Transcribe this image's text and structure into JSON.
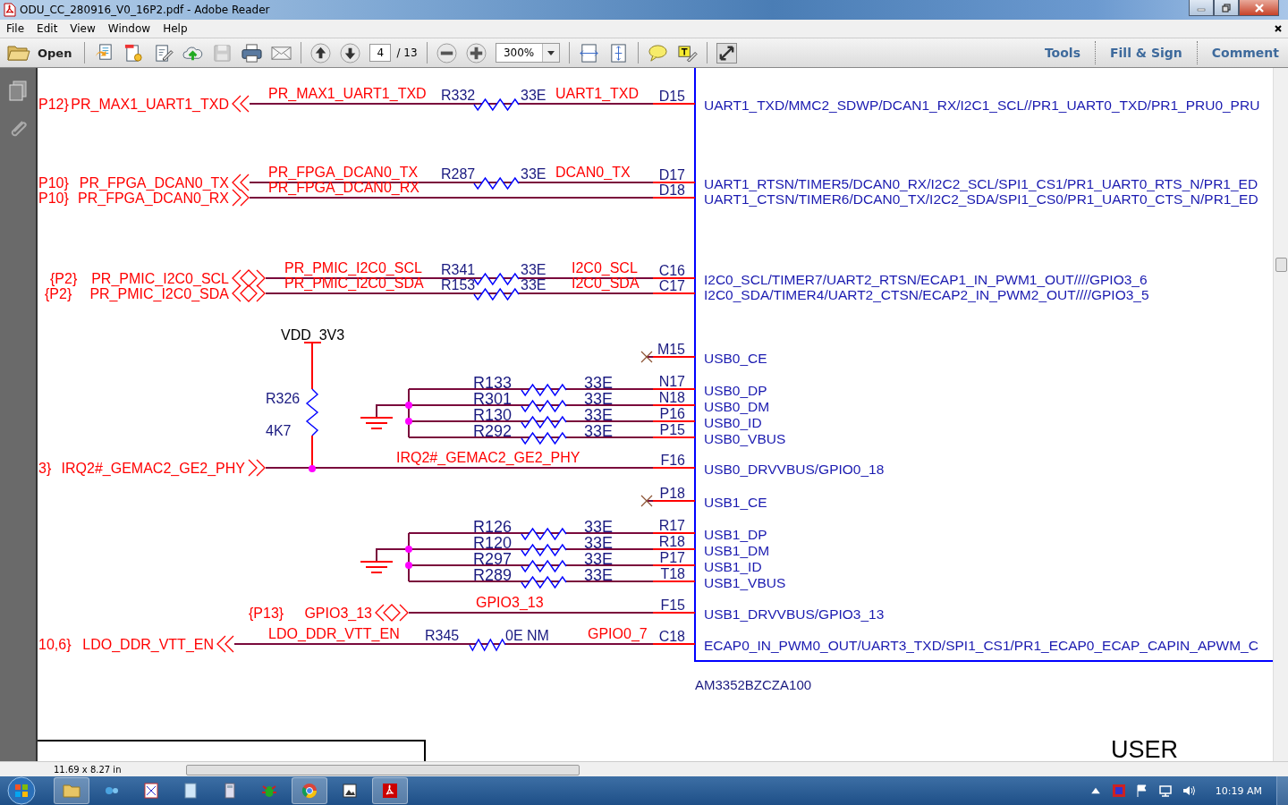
{
  "window": {
    "title": "ODU_CC_280916_V0_16P2.pdf - Adobe Reader"
  },
  "menu": [
    "File",
    "Edit",
    "View",
    "Window",
    "Help"
  ],
  "toolbar": {
    "open": "Open",
    "page": "4",
    "page_count": "/ 13",
    "zoom": "300%",
    "panels": [
      "Tools",
      "Fill & Sign",
      "Comment"
    ]
  },
  "schematic": {
    "rows": [
      {
        "kind": "series",
        "sheet_ref": "P12}",
        "port": {
          "net": "PR_MAX1_UART1_TXD",
          "kind": "output"
        },
        "net_label": "PR_MAX1_UART1_TXD",
        "res_ref": "R332",
        "res_value": "33E",
        "pin_net": "UART1_TXD",
        "pin": "D15",
        "pad": "UART1_TXD/MMC2_SDWP/DCAN1_RX/I2C1_SCL//PR1_UART0_TXD/PR1_PRU0_PRU"
      },
      {
        "kind": "series",
        "sheet_ref": "P10}",
        "port": {
          "net": "PR_FPGA_DCAN0_TX",
          "kind": "output"
        },
        "net_label": "PR_FPGA_DCAN0_TX",
        "res_ref": "R287",
        "res_value": "33E",
        "pin_net": "DCAN0_TX",
        "pin": "D17",
        "pad": "UART1_RTSN/TIMER5/DCAN0_RX/I2C2_SCL/SPI1_CS1/PR1_UART0_RTS_N/PR1_ED"
      },
      {
        "kind": "direct",
        "sheet_ref": "P10}",
        "port": {
          "net": "PR_FPGA_DCAN0_RX",
          "kind": "input"
        },
        "net_label": "PR_FPGA_DCAN0_RX",
        "pin": "D18",
        "pad": "UART1_CTSN/TIMER6/DCAN0_TX/I2C2_SDA/SPI1_CS0/PR1_UART0_CTS_N/PR1_ED"
      },
      {
        "kind": "series",
        "sheet_ref": "{P2}",
        "port": {
          "net": "PR_PMIC_I2C0_SCL",
          "kind": "bidir"
        },
        "net_label": "PR_PMIC_I2C0_SCL",
        "res_ref": "R341",
        "res_value": "33E",
        "pin_net": "I2C0_SCL",
        "pin": "C16",
        "pad": "I2C0_SCL/TIMER7/UART2_RTSN/ECAP1_IN_PWM1_OUT////GPIO3_6"
      },
      {
        "kind": "series",
        "sheet_ref": "{P2}",
        "port": {
          "net": "PR_PMIC_I2C0_SDA",
          "kind": "bidir"
        },
        "net_label": "PR_PMIC_I2C0_SDA",
        "res_ref": "R153",
        "res_value": "33E",
        "pin_net": "I2C0_SDA",
        "pin": "C17",
        "pad": "I2C0_SDA/TIMER4/UART2_CTSN/ECAP2_IN_PWM2_OUT////GPIO3_5"
      },
      {
        "kind": "nc",
        "pin": "M15",
        "pad": "USB0_CE"
      },
      {
        "kind": "usb",
        "res_ref": "R133",
        "res_value": "33E",
        "pin": "N17",
        "pad": "USB0_DP"
      },
      {
        "kind": "usb",
        "res_ref": "R301",
        "res_value": "33E",
        "pin": "N18",
        "pad": "USB0_DM"
      },
      {
        "kind": "usb",
        "res_ref": "R130",
        "res_value": "33E",
        "pin": "P16",
        "pad": "USB0_ID"
      },
      {
        "kind": "usb",
        "res_ref": "R292",
        "res_value": "33E",
        "pin": "P15",
        "pad": "USB0_VBUS"
      },
      {
        "kind": "direct",
        "sheet_ref": "3}",
        "port": {
          "net": "IRQ2#_GEMAC2_GE2_PHY",
          "kind": "input"
        },
        "net_label": "IRQ2#_GEMAC2_GE2_PHY",
        "pin": "F16",
        "pad": "USB0_DRVVBUS/GPIO0_18"
      },
      {
        "kind": "nc",
        "pin": "P18",
        "pad": "USB1_CE"
      },
      {
        "kind": "usb",
        "res_ref": "R126",
        "res_value": "33E",
        "pin": "R17",
        "pad": "USB1_DP"
      },
      {
        "kind": "usb",
        "res_ref": "R120",
        "res_value": "33E",
        "pin": "R18",
        "pad": "USB1_DM"
      },
      {
        "kind": "usb",
        "res_ref": "R297",
        "res_value": "33E",
        "pin": "P17",
        "pad": "USB1_ID"
      },
      {
        "kind": "usb",
        "res_ref": "R289",
        "res_value": "33E",
        "pin": "T18",
        "pad": "USB1_VBUS"
      },
      {
        "kind": "direct",
        "sheet_ref": "{P13}",
        "port": {
          "net": "GPIO3_13",
          "kind": "bidir"
        },
        "net_label": "GPIO3_13",
        "pin": "F15",
        "pad": "USB1_DRVVBUS/GPIO3_13"
      },
      {
        "kind": "series",
        "sheet_ref": "10,6}",
        "port": {
          "net": "LDO_DDR_VTT_EN",
          "kind": "output"
        },
        "net_label": "LDO_DDR_VTT_EN",
        "res_ref": "R345",
        "res_value": "0E NM",
        "pin_net": "GPIO0_7",
        "pin": "C18",
        "pad": "ECAP0_IN_PWM0_OUT/UART3_TXD/SPI1_CS1/PR1_ECAP0_ECAP_CAPIN_APWM_C"
      }
    ],
    "power_label": "VDD_3V3",
    "pullup_ref": "R326",
    "pullup_value": "4K7",
    "part_number": "AM3352BZCZA100",
    "title_block": "USER"
  },
  "status_bar": {
    "page_size": "11.69 x 8.27 in"
  },
  "taskbar": {
    "clock": "10:19 AM"
  }
}
